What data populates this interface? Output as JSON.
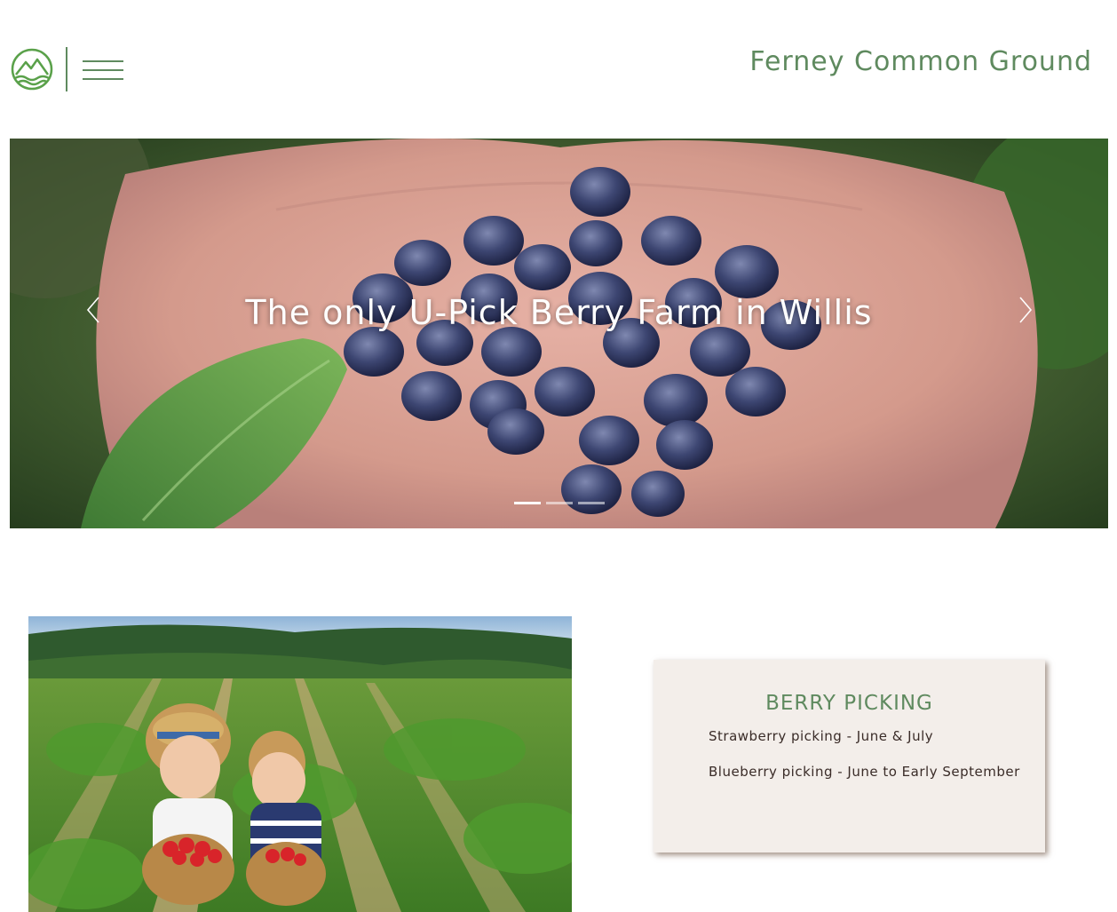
{
  "header": {
    "logo_icon": "mountain-logo-icon",
    "menu_icon": "hamburger-menu-icon",
    "site_title": "Ferney Common Ground",
    "brand_color": "#5f8a5f"
  },
  "hero": {
    "caption": "The only U-Pick Berry Farm in Willis",
    "prev_icon": "chevron-left-icon",
    "next_icon": "chevron-right-icon",
    "slide_count": 3,
    "active_slide": 1
  },
  "feature": {
    "image_alt": "Children picking strawberries",
    "card": {
      "title": "BERRY PICKING",
      "lines": [
        "Strawberry picking - June & July",
        "Blueberry picking - June to Early September"
      ]
    }
  }
}
